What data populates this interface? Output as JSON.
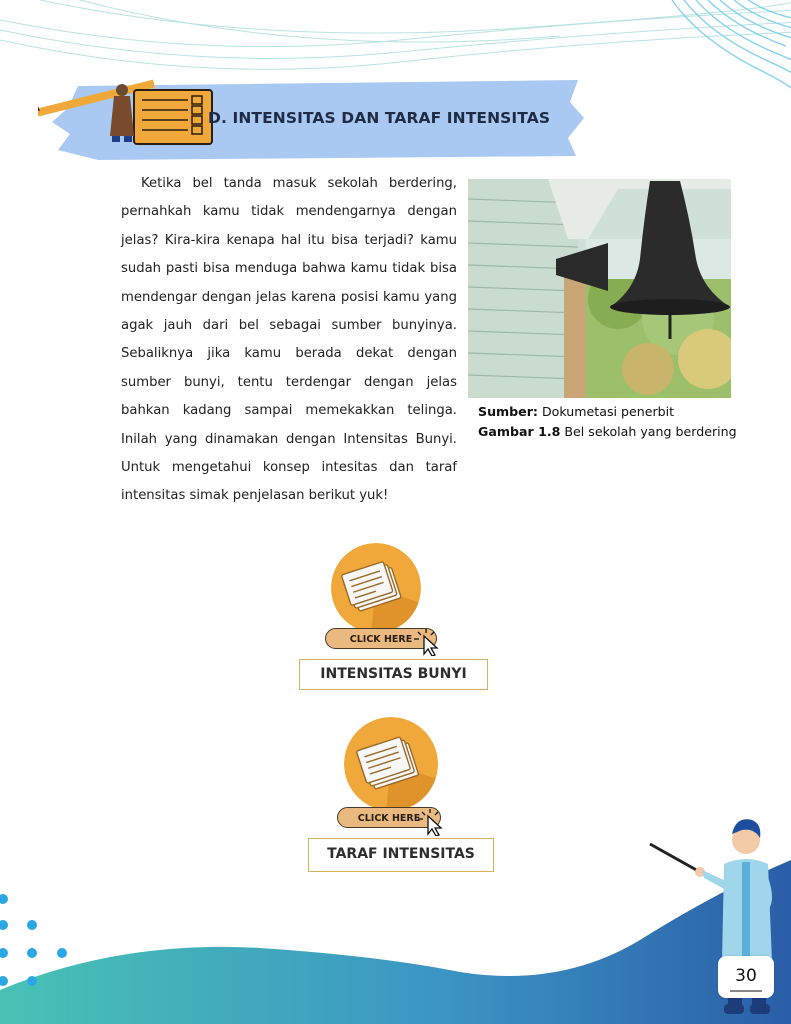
{
  "section": {
    "title": "D. INTENSITAS DAN TARAF INTENSITAS"
  },
  "body": {
    "paragraph": "Ketika bel tanda masuk sekolah berdering, pernahkah kamu tidak mendengarnya dengan jelas? Kira-kira kenapa hal itu bisa terjadi? kamu sudah pasti bisa menduga bahwa kamu tidak bisa mendengar dengan jelas karena posisi kamu yang agak jauh dari bel sebagai sumber bunyinya. Sebaliknya jika kamu berada dekat dengan sumber bunyi, tentu terdengar dengan jelas bahkan kadang sampai memekakkan telinga. Inilah yang dinamakan dengan Intensitas Bunyi. Untuk mengetahui konsep intesitas dan taraf  intensitas simak penjelasan berikut yuk!"
  },
  "figure": {
    "source_label": "Sumber:",
    "source_text": "Dokumetasi penerbit",
    "caption_label": "Gambar 1.8",
    "caption_text": "Bel sekolah yang berdering"
  },
  "buttons": [
    {
      "click_label": "CLICK HERE",
      "title": "INTENSITAS BUNYI"
    },
    {
      "click_label": "CLICK HERE",
      "title": "TARAF INTENSITAS"
    }
  ],
  "page": {
    "number": "30"
  },
  "colors": {
    "header_band": "#a9c9f2",
    "circle_orange": "#f0a83a",
    "pill_fill": "#e9b97f",
    "label_border": "#d6b25a",
    "wave_teal": "#3fb6b2",
    "wave_blue": "#2f6fb0",
    "dot_blue": "#2aa7e6"
  },
  "icons": [
    "document-stack-icon",
    "cursor-click-icon",
    "bell-photo",
    "teacher-illustration",
    "pencil-man-illustration"
  ]
}
